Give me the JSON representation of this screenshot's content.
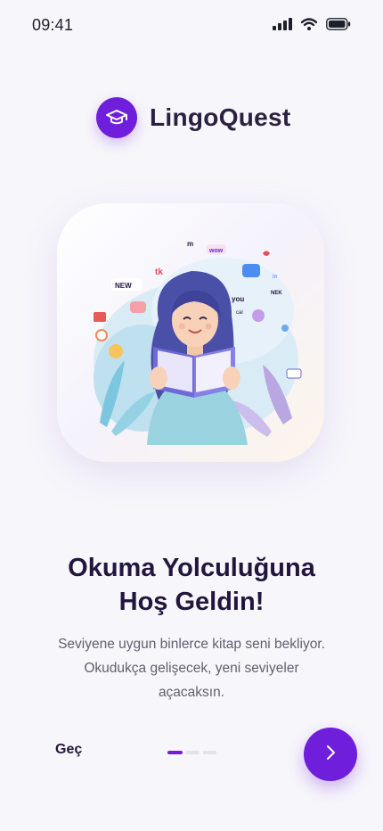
{
  "status_bar": {
    "time": "09:41",
    "icons": [
      "signal-icon",
      "wifi-icon",
      "battery-icon"
    ]
  },
  "brand": {
    "name": "LingoQuest",
    "logo_icon": "graduation-cap-icon"
  },
  "illustration": {
    "description_icon": "woman-reading-book-illustration",
    "bubble_words": [
      "NEW",
      "tk",
      "m",
      "wow",
      "in",
      "you",
      "NEK",
      "cal"
    ]
  },
  "onboarding": {
    "title_line1": "Okuma Yolculuğuna",
    "title_line2": "Hoş Geldin!",
    "desc_line1": "Seviyene uygun binlerce kitap seni bekliyor.",
    "desc_line2": "Okudukça gelişecek, yeni seviyeler",
    "desc_line3": "açacaksın."
  },
  "footer": {
    "skip_label": "Geç",
    "page_count": 3,
    "active_page": 1,
    "next_icon": "chevron-right-icon"
  },
  "colors": {
    "accent": "#6f1fdc",
    "title": "#22163e",
    "body_text": "#62606f",
    "background": "#f7f6fb"
  }
}
